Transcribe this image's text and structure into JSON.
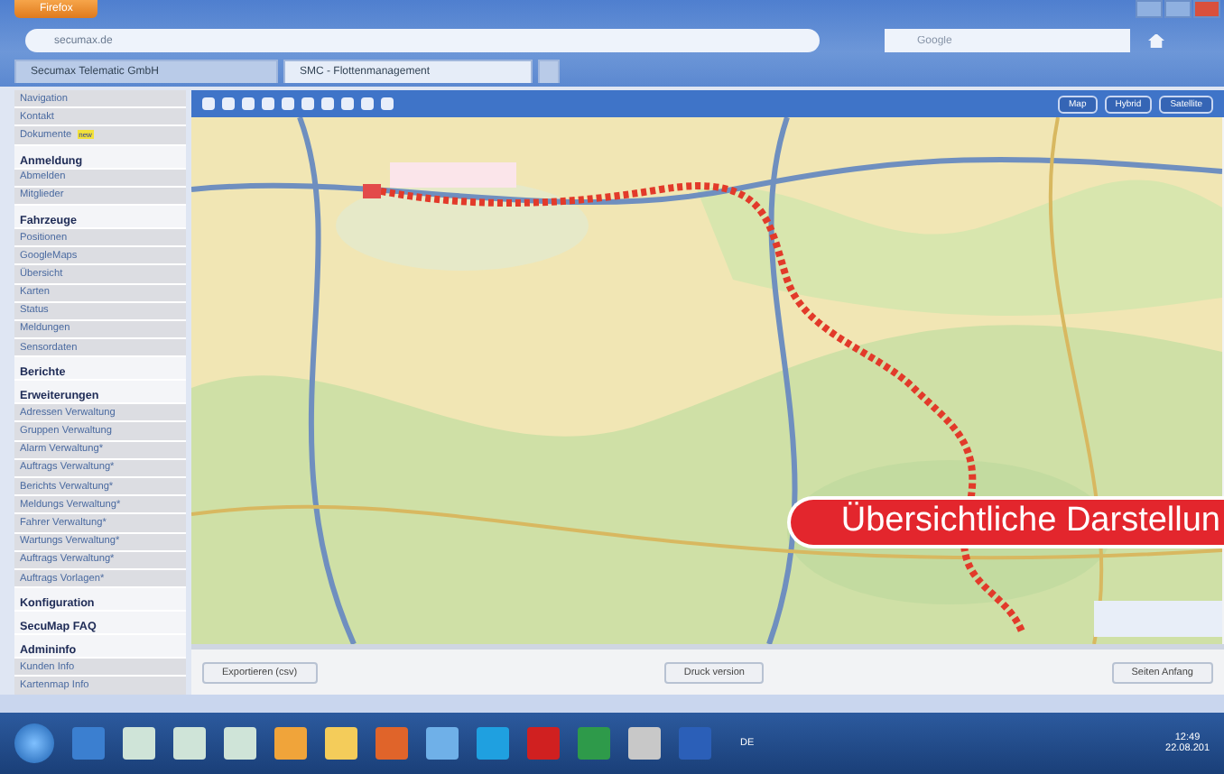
{
  "browser": {
    "menu_button": "Firefox",
    "address": "secumax.de",
    "search_placeholder": "Google",
    "tabs": [
      {
        "label": "Secumax Telematic GmbH",
        "selected": false
      },
      {
        "label": "SMC - Flottenmanagement",
        "selected": true
      }
    ]
  },
  "sidebar": {
    "items": [
      {
        "label": "Navigation",
        "kind": "link"
      },
      {
        "label": "Kontakt",
        "kind": "link"
      },
      {
        "label": "Dokumente",
        "kind": "link",
        "badge": "new"
      },
      {
        "label": "Anmeldung",
        "kind": "header"
      },
      {
        "label": "Abmelden",
        "kind": "link"
      },
      {
        "label": "Mitglieder",
        "kind": "link"
      },
      {
        "label": "Fahrzeuge",
        "kind": "header"
      },
      {
        "label": "Positionen",
        "kind": "link"
      },
      {
        "label": "GoogleMaps",
        "kind": "link"
      },
      {
        "label": "Übersicht",
        "kind": "link"
      },
      {
        "label": "Karten",
        "kind": "link"
      },
      {
        "label": "Status",
        "kind": "link"
      },
      {
        "label": "Meldungen",
        "kind": "link"
      },
      {
        "label": "Sensordaten",
        "kind": "link"
      },
      {
        "label": "Berichte",
        "kind": "header"
      },
      {
        "label": "Erweiterungen",
        "kind": "header"
      },
      {
        "label": "Adressen Verwaltung",
        "kind": "link"
      },
      {
        "label": "Gruppen Verwaltung",
        "kind": "link"
      },
      {
        "label": "Alarm Verwaltung*",
        "kind": "link"
      },
      {
        "label": "Auftrags Verwaltung*",
        "kind": "link"
      },
      {
        "label": "Berichts Verwaltung*",
        "kind": "link"
      },
      {
        "label": "Meldungs Verwaltung*",
        "kind": "link"
      },
      {
        "label": "Fahrer Verwaltung*",
        "kind": "link"
      },
      {
        "label": "Wartungs Verwaltung*",
        "kind": "link"
      },
      {
        "label": "Auftrags Verwaltung*",
        "kind": "link"
      },
      {
        "label": "Auftrags Vorlagen*",
        "kind": "link"
      },
      {
        "label": "Konfiguration",
        "kind": "header"
      },
      {
        "label": "SecuMap FAQ",
        "kind": "header"
      },
      {
        "label": "Admininfo",
        "kind": "header"
      },
      {
        "label": "Kunden Info",
        "kind": "link"
      },
      {
        "label": "Kartenmap Info",
        "kind": "link"
      }
    ]
  },
  "map": {
    "view_buttons": [
      "Map",
      "Hybrid",
      "Satellite"
    ],
    "banner": "Übersichtliche Darstellun"
  },
  "footer": {
    "buttons": [
      "Exportieren (csv)",
      "Druck version",
      "Seiten Anfang"
    ]
  },
  "taskbar": {
    "language": "DE",
    "time": "12:49",
    "date": "22.08.201"
  }
}
